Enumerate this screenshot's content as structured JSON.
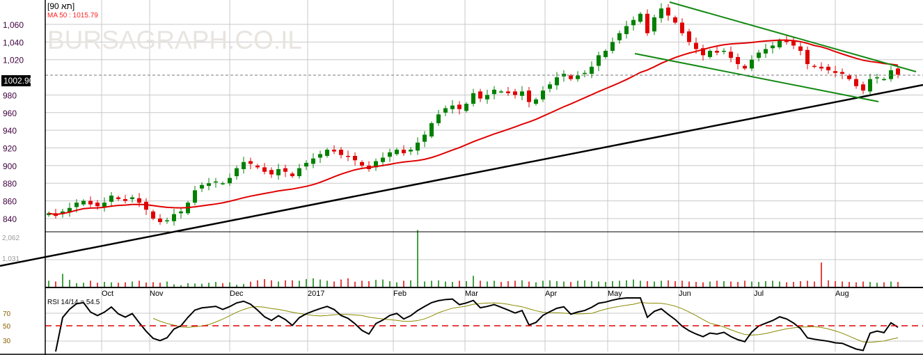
{
  "header": {
    "title": "[90 תא]",
    "ma_label": "MA 50 : 1015.79",
    "watermark": "BURSAGRAPH.CO.IL"
  },
  "colors": {
    "up": "#008000",
    "down": "#e00000",
    "ma": "#e00000",
    "trend": "#000000",
    "channel": "#118811",
    "rsi": "#000000",
    "rsi_signal": "#8a8a00"
  },
  "chart_data": {
    "type": "candlestick",
    "title": "[90 תא]",
    "last_price": 1002.9,
    "last_price_label": "1002.90",
    "ma50_last": 1015.79,
    "ylim": [
      830,
      1080
    ],
    "yticks": [
      840,
      860,
      880,
      900,
      920,
      940,
      960,
      980,
      1020,
      1040,
      1060
    ],
    "ytick_labels": [
      "840",
      "860",
      "880",
      "900",
      "920",
      "940",
      "960",
      "980",
      "1,020",
      "1,040",
      "1,060"
    ],
    "months": [
      "Oct",
      "Nov",
      "Dec",
      "2017",
      "Feb",
      "Mar",
      "Apr",
      "May",
      "Jun",
      "Jul",
      "Aug"
    ],
    "month_index": [
      8,
      15,
      26,
      37,
      50,
      60,
      71,
      80,
      91,
      101,
      113
    ],
    "close": [
      846,
      843,
      848,
      852,
      858,
      860,
      856,
      854,
      858,
      866,
      862,
      860,
      864,
      858,
      850,
      840,
      836,
      838,
      845,
      848,
      858,
      872,
      878,
      880,
      882,
      880,
      886,
      897,
      904,
      902,
      898,
      893,
      890,
      896,
      893,
      888,
      897,
      903,
      908,
      913,
      918,
      916,
      912,
      910,
      906,
      900,
      896,
      905,
      909,
      915,
      918,
      914,
      918,
      926,
      935,
      948,
      958,
      965,
      968,
      964,
      970,
      982,
      976,
      980,
      986,
      984,
      982,
      980,
      984,
      972,
      975,
      985,
      992,
      1000,
      1004,
      998,
      1002,
      1005,
      1012,
      1025,
      1030,
      1040,
      1050,
      1058,
      1065,
      1072,
      1050,
      1068,
      1078,
      1070,
      1062,
      1050,
      1040,
      1032,
      1025,
      1030,
      1028,
      1030,
      1022,
      1015,
      1010,
      1020,
      1028,
      1032,
      1036,
      1042,
      1040,
      1036,
      1030,
      1015,
      1012,
      1010,
      1008,
      1005,
      1004,
      998,
      990,
      985,
      998,
      1000,
      998,
      1008,
      1003
    ],
    "volume": {
      "axis_labels": [
        "2,062",
        "1,031"
      ],
      "axis_values": [
        2062,
        1031
      ],
      "values": [
        300,
        260,
        640,
        340,
        180,
        200,
        300,
        200,
        240,
        220,
        200,
        220,
        260,
        300,
        210,
        230,
        200,
        260,
        120,
        80,
        180,
        160,
        150,
        200,
        240,
        180,
        220,
        100,
        140,
        250,
        320,
        380,
        320,
        260,
        320,
        320,
        300,
        380,
        420,
        360,
        300,
        260,
        360,
        420,
        250,
        300,
        280,
        340,
        360,
        280,
        220,
        300,
        320,
        2800,
        260,
        300,
        320,
        260,
        240,
        300,
        280,
        540,
        300,
        260,
        300,
        240,
        280,
        300,
        320,
        260,
        220,
        300,
        320,
        280,
        260,
        240,
        300,
        320,
        280,
        260,
        240,
        280,
        300,
        320,
        360,
        300,
        280,
        260,
        300,
        320,
        280,
        300,
        260,
        240,
        220,
        260,
        300,
        280,
        260,
        240,
        300,
        260,
        240,
        280,
        300,
        260,
        220,
        240,
        280,
        300,
        260,
        1200,
        320,
        280,
        260,
        240,
        220,
        260,
        240,
        200,
        220,
        260,
        240
      ]
    },
    "rsi": {
      "label": "RSI 14/14 = 54.5",
      "period": 14,
      "value": 54.5,
      "levels": [
        70,
        50,
        30
      ],
      "level_labels": [
        "70",
        "50",
        "30"
      ]
    }
  }
}
